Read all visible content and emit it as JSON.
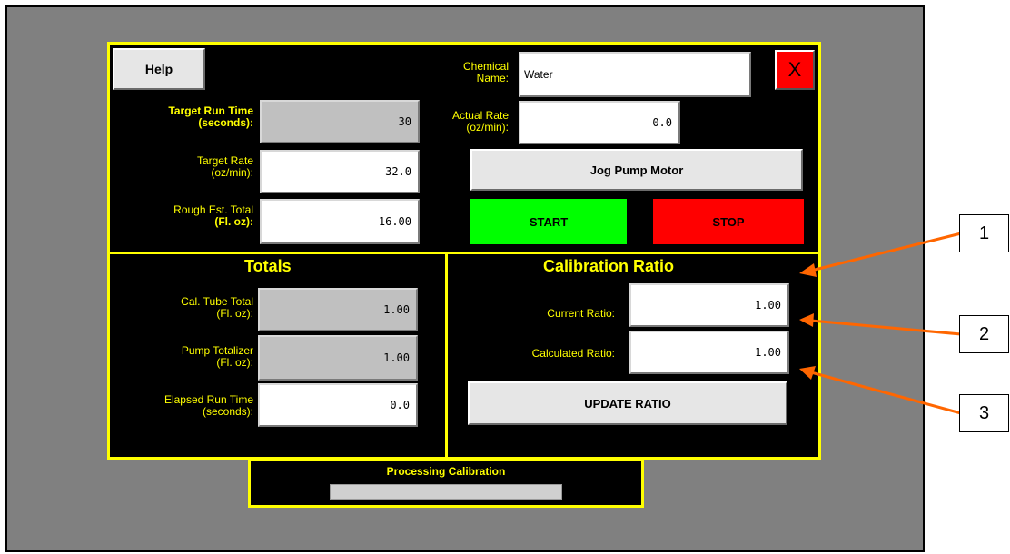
{
  "header": {
    "help_label": "Help",
    "close_label": "X"
  },
  "chemical": {
    "label_line1": "Chemical",
    "label_line2": "Name:",
    "value": "Water"
  },
  "actual_rate": {
    "label_line1": "Actual Rate",
    "label_line2": "(oz/min):",
    "value": "0.0"
  },
  "target_run_time": {
    "label_line1": "Target Run Time",
    "label_line2": "(seconds):",
    "value": "30"
  },
  "target_rate": {
    "label_line1": "Target Rate",
    "label_line2": "(oz/min):",
    "value": "32.0"
  },
  "rough_total": {
    "label_line1": "Rough Est. Total",
    "label_line2": "(Fl. oz):",
    "value": "16.00"
  },
  "buttons": {
    "jog": "Jog Pump Motor",
    "start": "START",
    "stop": "STOP",
    "update_ratio": "UPDATE RATIO"
  },
  "totals": {
    "title": "Totals",
    "cal_tube": {
      "label_line1": "Cal. Tube Total",
      "label_line2": "(Fl. oz):",
      "value": "1.00"
    },
    "pump_totalizer": {
      "label_line1": "Pump Totalizer",
      "label_line2": "(Fl. oz):",
      "value": "1.00"
    },
    "elapsed": {
      "label_line1": "Elapsed Run Time",
      "label_line2": "(seconds):",
      "value": "0.0"
    }
  },
  "calibration": {
    "title": "Calibration Ratio",
    "current": {
      "label": "Current Ratio:",
      "value": "1.00"
    },
    "calculated": {
      "label": "Calculated Ratio:",
      "value": "1.00"
    }
  },
  "status": {
    "label": "Processing Calibration",
    "progress": 0
  },
  "callouts": [
    "1",
    "2",
    "3"
  ],
  "colors": {
    "panel_border": "#ffff00",
    "start": "#00ff00",
    "stop": "#ff0000",
    "arrow": "#ff6600"
  }
}
